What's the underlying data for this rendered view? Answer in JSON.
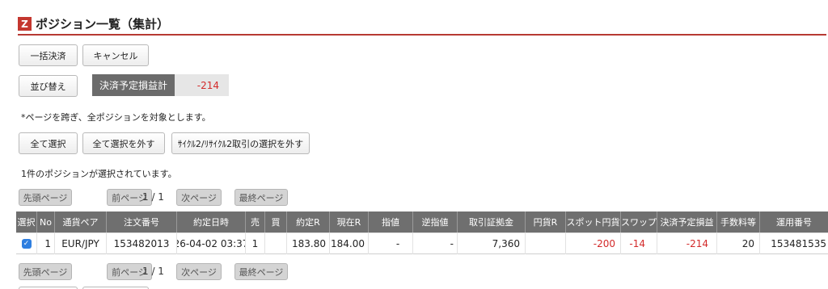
{
  "header": {
    "logo": "Z",
    "title": "ポジション一覧（集計）"
  },
  "actions": {
    "bulk_settle": "一括決済",
    "cancel": "キャンセル",
    "sort": "並び替え"
  },
  "summary": {
    "label": "決済予定損益計",
    "value": "-214"
  },
  "note": "*ページを跨ぎ、全ポジションを対象とします。",
  "selection": {
    "select_all": "全て選択",
    "deselect_all": "全て選択を外す",
    "deselect_cycle": "ｻｲｸﾙ2/ﾘｻｲｸﾙ2取引の選択を外す",
    "status": "1件のポジションが選択されています。"
  },
  "pagination": {
    "first": "先頭ページ",
    "prev": "前ページ",
    "indicator": "1 / 1",
    "next": "次ページ",
    "last": "最終ページ"
  },
  "table": {
    "headers": [
      "選択",
      "No",
      "通貨ペア",
      "注文番号",
      "約定日時",
      "売",
      "買",
      "約定R",
      "現在R",
      "指値",
      "逆指値",
      "取引証拠金",
      "円貨R",
      "スポット円貨",
      "スワップ",
      "決済予定損益",
      "手数料等",
      "運用番号"
    ],
    "rows": [
      {
        "selected": true,
        "no": "1",
        "pair": "EUR/JPY",
        "order_no": "153482013",
        "datetime": "26-04-02 03:37",
        "sell": "1",
        "buy": "",
        "exec_rate": "183.80",
        "current_rate": "184.00",
        "limit": "-",
        "stop": "-",
        "margin": "7,360",
        "yen_rate": "",
        "spot_yen": "-200",
        "swap": "-14",
        "pnl": "-214",
        "fee": "20",
        "op_no": "153481535"
      }
    ]
  },
  "colors": {
    "accent": "#c4372f",
    "negative": "#d32a2a",
    "header_bg": "#6f6f6f",
    "checkbox": "#2f7fe0"
  }
}
